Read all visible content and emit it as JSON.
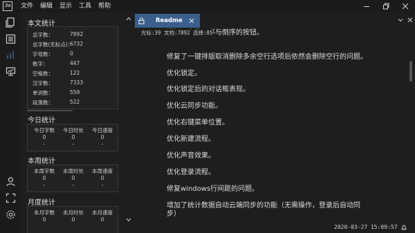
{
  "app": {
    "logo_text": "Jia"
  },
  "menu": [
    "文件",
    "编辑",
    "显示",
    "工具",
    "帮助"
  ],
  "icons": {
    "files": "files-icon",
    "outline": "outline-icon",
    "stats": "bar-chart-icon",
    "slides": "presentation-icon",
    "user": "user-icon",
    "fullscreen": "fullscreen-icon",
    "settings": "gear-icon"
  },
  "stats": {
    "text_title": "本文统计",
    "text_items": [
      {
        "label": "总字数：",
        "value": "7892"
      },
      {
        "label": "总字数(无标点)：",
        "value": "6732"
      },
      {
        "label": "字母数：",
        "value": "0"
      },
      {
        "label": "数字：",
        "value": "447"
      },
      {
        "label": "空格数：",
        "value": "122"
      },
      {
        "label": "汉字数：",
        "value": "7333"
      },
      {
        "label": "单词数：",
        "value": "559"
      },
      {
        "label": "段落数：",
        "value": "522"
      }
    ],
    "today_title": "今日统计",
    "today": [
      {
        "label": "今日字数",
        "value": "0",
        "sub": "-"
      },
      {
        "label": "今日时长",
        "value": "0",
        "sub": "-"
      },
      {
        "label": "今日速度",
        "value": "0",
        "sub": "-"
      }
    ],
    "week_title": "本周统计",
    "week": [
      {
        "label": "本周字数",
        "value": "0",
        "sub": "-"
      },
      {
        "label": "本周时长",
        "value": "0",
        "sub": "-"
      },
      {
        "label": "本周速度",
        "value": "0",
        "sub": "-"
      }
    ],
    "month_title": "月度统计",
    "month": [
      {
        "label": "本月字数",
        "value": "0"
      },
      {
        "label": "本月时长",
        "value": "0"
      },
      {
        "label": "本月速度",
        "value": "0"
      }
    ]
  },
  "tab": {
    "label": "Readme"
  },
  "status_line": "光标:39 文档:7892 选择:85",
  "editor_lines": [
    "增加了文件正序与倒序的按钮。",
    "修复了一键排版取消删除多余空行选项后依然会删除空行的问题。",
    "优化锁定。",
    "优化锁定后的对话框表现。",
    "优化云同步功能。",
    "优化右键菜单位置。",
    "优化新建流程。",
    "优化声音效果。",
    "优化登录流程。",
    "修复windows行间距的问题。",
    "增加了统计数据自动云端同步的功能（无需操作，登录后自动同",
    "步）"
  ],
  "datetime": "2020-03-27 15:09:57",
  "colors": {
    "tab_active": "#3a5f8c",
    "accent_icon": "#4a78a8",
    "background": "#1e1e1e"
  }
}
